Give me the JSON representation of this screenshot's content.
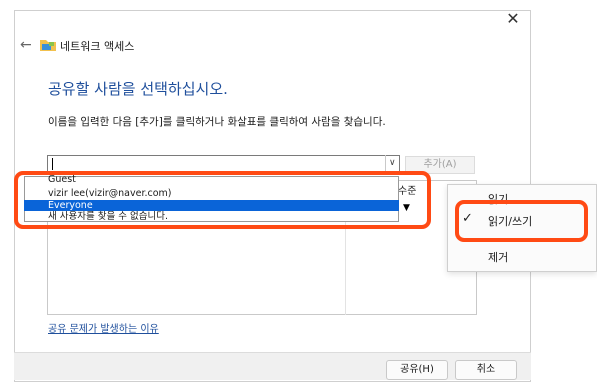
{
  "window": {
    "title": "네트워크 액세스",
    "close_label": "✕",
    "back_label": "←"
  },
  "main": {
    "heading": "공유할 사람을 선택하십시오.",
    "description": "이름을 입력한 다음 [추가]를 클릭하거나 화살표를 클릭하여 사람을 찾습니다.",
    "name_input_value": "",
    "add_button": "추가(A)",
    "level_header": "수준"
  },
  "dropdown": {
    "items": [
      {
        "label": "Guest",
        "selected": false
      },
      {
        "label": "vizir lee(vizir@naver.com)",
        "selected": false
      },
      {
        "label": "Everyone",
        "selected": true
      },
      {
        "label": "새 사용자를 찾을 수 없습니다.",
        "selected": false
      }
    ]
  },
  "permission_menu": {
    "items": [
      {
        "label": "읽기",
        "checked": false
      },
      {
        "label": "읽기/쓰기",
        "checked": true
      },
      {
        "label": "제거",
        "checked": false
      }
    ]
  },
  "link": "공유 문제가 발생하는 이유",
  "footer": {
    "share_button": "공유(H)",
    "cancel_button": "취소"
  },
  "colors": {
    "accent": "#1f4f9c",
    "highlight": "#ff4a14",
    "selection": "#0a64d8"
  }
}
